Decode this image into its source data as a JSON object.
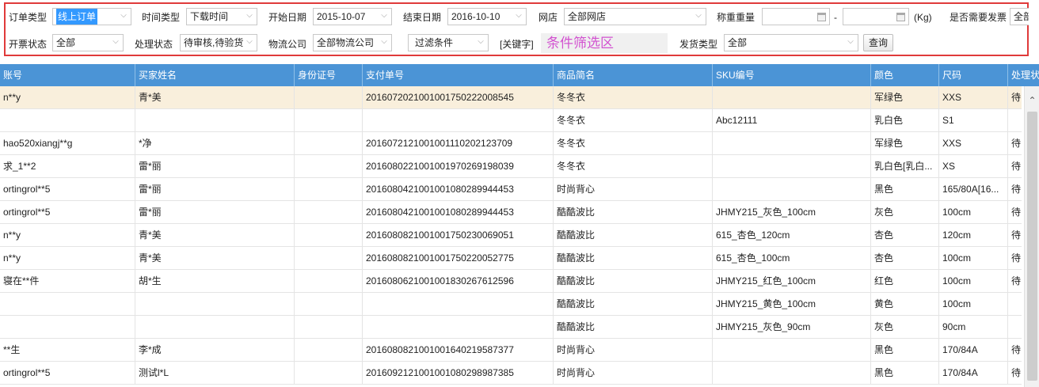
{
  "filters": {
    "order_type": {
      "label": "订单类型",
      "value": "线上订单"
    },
    "time_type": {
      "label": "时间类型",
      "value": "下载时间"
    },
    "start_date": {
      "label": "开始日期",
      "value": "2015-10-07"
    },
    "end_date": {
      "label": "结束日期",
      "value": "2016-10-10"
    },
    "shop": {
      "label": "网店",
      "value": "全部网店"
    },
    "weight": {
      "label": "称重重量",
      "separator": "-",
      "unit": "(Kg)"
    },
    "need_invoice": {
      "label": "是否需要发票",
      "value": "全部"
    },
    "invoice_status": {
      "label": "开票状态",
      "value": "全部"
    },
    "process_status": {
      "label": "处理状态",
      "value": "待审核,待验货"
    },
    "logistics": {
      "label": "物流公司",
      "value": "全部物流公司"
    },
    "filter_condition": {
      "value": "过滤条件"
    },
    "keyword": {
      "label": "[关键字]",
      "annotation": "条件筛选区"
    },
    "ship_type": {
      "label": "发货类型",
      "value": "全部"
    },
    "query_button": "查询"
  },
  "table": {
    "columns": [
      "账号",
      "买家姓名",
      "身份证号",
      "支付单号",
      "商品简名",
      "SKU编号",
      "颜色",
      "尺码",
      "处理状"
    ],
    "rows": [
      [
        "n**y",
        "青*美",
        "",
        "201607202100100175022200854​5",
        "冬冬衣",
        "",
        "军绿色",
        "XXS",
        "待"
      ],
      [
        "",
        "",
        "",
        "",
        "冬冬衣",
        "Abc12111",
        "乳白色",
        "S1",
        ""
      ],
      [
        "hao520xiangj**g",
        "*净",
        "",
        "2016072121001001110202123709",
        "冬冬衣",
        "",
        "军绿色",
        "XXS",
        "待"
      ],
      [
        "求_1**2",
        "雷*丽",
        "",
        "2016080221001001970269198039",
        "冬冬衣",
        "",
        "乳白色[乳白...",
        "XS",
        "待"
      ],
      [
        "ortingrol**5",
        "雷*丽",
        "",
        "2016080421001001080289944453",
        "时尚背心",
        "",
        "黑色",
        "165/80A[16...",
        "待"
      ],
      [
        "ortingrol**5",
        "雷*丽",
        "",
        "2016080421001001080289944453",
        "酷酷波比",
        "JHMY215_灰色_100cm",
        "灰色",
        "100cm",
        "待"
      ],
      [
        "n**y",
        "青*美",
        "",
        "2016080821001001750230069051",
        "酷酷波比",
        "615_杏色_120cm",
        "杏色",
        "120cm",
        "待"
      ],
      [
        "n**y",
        "青*美",
        "",
        "2016080821001001750220052775",
        "酷酷波比",
        "615_杏色_100cm",
        "杏色",
        "100cm",
        "待"
      ],
      [
        "寝在**件",
        "胡*生",
        "",
        "2016080621001001830267612596",
        "酷酷波比",
        "JHMY215_红色_100cm",
        "红色",
        "100cm",
        "待"
      ],
      [
        "",
        "",
        "",
        "",
        "酷酷波比",
        "JHMY215_黄色_100cm",
        "黄色",
        "100cm",
        ""
      ],
      [
        "",
        "",
        "",
        "",
        "酷酷波比",
        "JHMY215_灰色_90cm",
        "灰色",
        "90cm",
        ""
      ],
      [
        "**生",
        "李*成",
        "",
        "2016080821001001640219587377",
        "时尚背心",
        "",
        "黑色",
        "170/84A",
        "待"
      ],
      [
        "ortingrol**5",
        "测试l*L",
        "",
        "2016092121001001080298987385",
        "时尚背心",
        "",
        "黑色",
        "170/84A",
        "待"
      ]
    ]
  },
  "colors": {
    "header_bg": "#4b94d6",
    "selected_row": "#f9efdc",
    "filter_border": "#e03a3a",
    "annotation": "#d252d0"
  },
  "icons": {
    "calendar": "calendar-icon",
    "dropdown": "chevron-down-icon",
    "scroll_up": "scroll-up-icon"
  }
}
